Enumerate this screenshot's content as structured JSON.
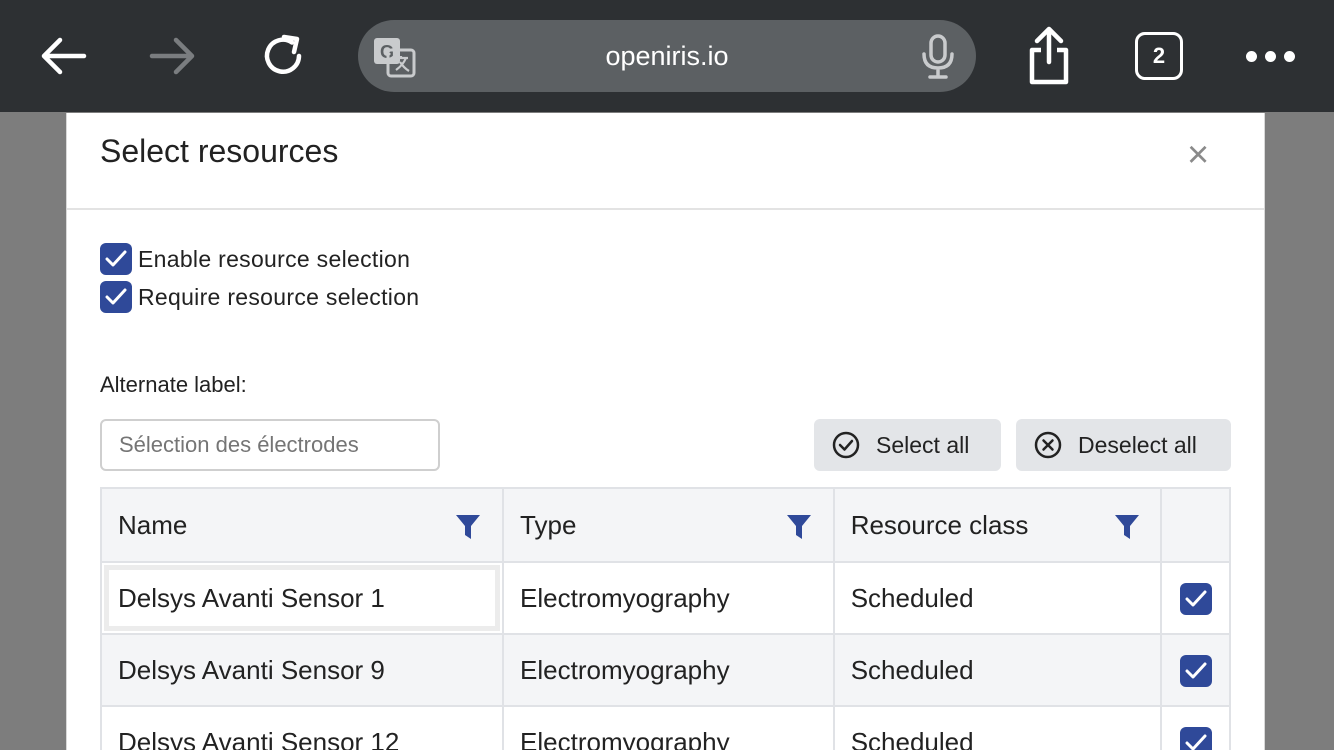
{
  "browser": {
    "url": "openiris.io",
    "tab_count": "2",
    "icons": [
      "back-arrow-icon",
      "forward-arrow-icon",
      "reload-icon",
      "translate-icon",
      "microphone-icon",
      "share-icon",
      "tabs-icon",
      "more-icon"
    ]
  },
  "modal": {
    "title": "Select resources",
    "close_label": "×",
    "enable_label": "Enable resource selection",
    "enable_checked": true,
    "require_label": "Require resource selection",
    "require_checked": true,
    "alt_label": "Alternate label:",
    "alt_placeholder": "Sélection des électrodes",
    "select_all_label": "Select all",
    "deselect_all_label": "Deselect all"
  },
  "table": {
    "columns": [
      "Name",
      "Type",
      "Resource class"
    ],
    "rows": [
      {
        "name": "Delsys Avanti Sensor 1",
        "type": "Electromyography",
        "resource_class": "Scheduled",
        "checked": true
      },
      {
        "name": "Delsys Avanti Sensor 9",
        "type": "Electromyography",
        "resource_class": "Scheduled",
        "checked": true
      },
      {
        "name": "Delsys Avanti Sensor 12",
        "type": "Electromyography",
        "resource_class": "Scheduled",
        "checked": true
      }
    ]
  },
  "colors": {
    "toolbar": "#2d3033",
    "accent": "#2f4999",
    "backdrop": "#7d7d7d"
  }
}
